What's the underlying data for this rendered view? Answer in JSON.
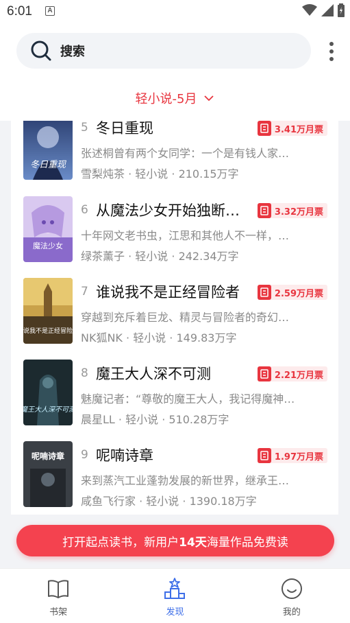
{
  "status": {
    "time": "6:01",
    "notif_letter": "A"
  },
  "search": {
    "label": "搜索"
  },
  "filter": {
    "label": "轻小说-5月"
  },
  "books": [
    {
      "rank": "5",
      "title": "冬日重现",
      "desc": "张述桐曾有两个女同学：一个是有钱人家…",
      "author": "雪梨炖茶",
      "category": "轻小说",
      "words": "210.15万字",
      "votes": "3.41万月票",
      "cover_text": "冬日重现"
    },
    {
      "rank": "6",
      "title": "从魔法少女开始独断…",
      "desc": "十年网文老书虫，江思和其他人不一样，…",
      "author": "绿茶薰子",
      "category": "轻小说",
      "words": "242.34万字",
      "votes": "3.32万月票",
      "cover_text": "魔法少女"
    },
    {
      "rank": "7",
      "title": "谁说我不是正经冒险者",
      "desc": "穿越到充斥着巨龙、精灵与冒险者的奇幻…",
      "author": "NK狐NK",
      "category": "轻小说",
      "words": "149.83万字",
      "votes": "2.59万月票",
      "cover_text": "谁说我不是正经冒险者"
    },
    {
      "rank": "8",
      "title": "魔王大人深不可测",
      "desc": "魅魔记者：“尊敬的魔王大人，我记得魔神…",
      "author": "晨星LL",
      "category": "轻小说",
      "words": "510.28万字",
      "votes": "2.21万月票",
      "cover_text": "魔王大人深不可测"
    },
    {
      "rank": "9",
      "title": "呢喃诗章",
      "desc": "来到蒸汽工业蓬勃发展的新世界，继承王…",
      "author": "咸鱼飞行家",
      "category": "轻小说",
      "words": "1390.18万字",
      "votes": "1.97万月票",
      "cover_text": "呢喃诗章"
    }
  ],
  "meta_sep": " · ",
  "cta": {
    "prefix": "打开起点读书，新用户",
    "highlight": "14天",
    "suffix": "海量作品免费读"
  },
  "tabs": [
    {
      "label": "书架",
      "icon": "book-icon"
    },
    {
      "label": "发现",
      "icon": "discover-icon",
      "active": true
    },
    {
      "label": "我的",
      "icon": "smile-icon"
    }
  ],
  "colors": {
    "accent": "#e8353f",
    "cta": "#f4424f",
    "tab_active": "#3d6ee8"
  }
}
